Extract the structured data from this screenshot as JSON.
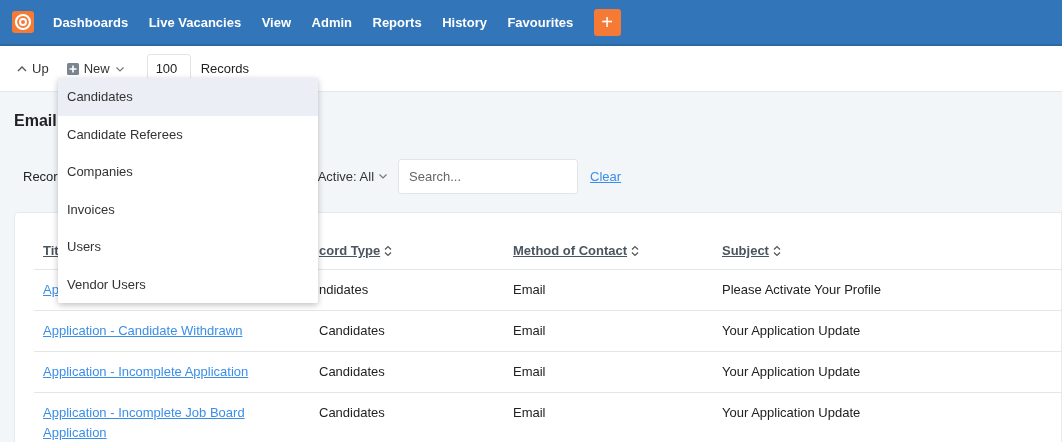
{
  "nav": {
    "items": [
      "Dashboards",
      "Live Vacancies",
      "View",
      "Admin",
      "Reports",
      "History",
      "Favourites"
    ],
    "add_button": "+"
  },
  "toolbar": {
    "up": "Up",
    "new": "New",
    "records_value": "100",
    "records_label": "Records"
  },
  "new_menu": [
    {
      "label": "Candidates",
      "selected": true
    },
    {
      "label": "Candidate Referees",
      "selected": false
    },
    {
      "label": "Companies",
      "selected": false
    },
    {
      "label": "Invoices",
      "selected": false
    },
    {
      "label": "Users",
      "selected": false
    },
    {
      "label": "Vendor Users",
      "selected": false
    }
  ],
  "page_title": "Email",
  "filters": {
    "label": "Recor",
    "active": "Active: All",
    "search": {
      "placeholder": "Search..."
    },
    "clear": "Clear"
  },
  "table": {
    "columns": [
      "Tit",
      "cord Type",
      "Method of Contact",
      "Subject"
    ],
    "rows": [
      [
        "Ap",
        "ndidates",
        "Email",
        "Please Activate Your Profile"
      ],
      [
        "Application - Candidate Withdrawn",
        "Candidates",
        "Email",
        "Your Application Update"
      ],
      [
        "Application - Incomplete Application",
        "Candidates",
        "Email",
        "Your Application Update"
      ],
      [
        "Application - Incomplete Job Board Application",
        "Candidates",
        "Email",
        "Your Application Update"
      ]
    ]
  }
}
